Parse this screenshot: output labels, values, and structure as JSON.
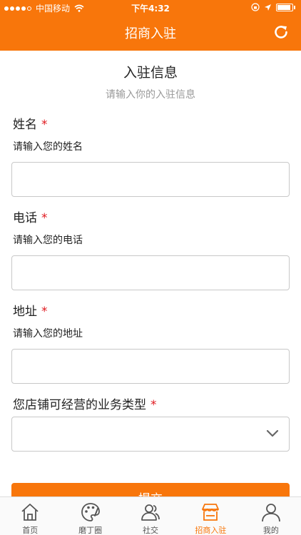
{
  "status_bar": {
    "carrier": "中国移动",
    "time": "下午4:32"
  },
  "nav": {
    "title": "招商入驻",
    "refresh_icon": "refresh-icon"
  },
  "form": {
    "title": "入驻信息",
    "subtitle": "请输入你的入驻信息",
    "required_mark": "*",
    "fields": [
      {
        "label": "姓名",
        "hint": "请输入您的姓名",
        "value": ""
      },
      {
        "label": "电话",
        "hint": "请输入您的电话",
        "value": ""
      },
      {
        "label": "地址",
        "hint": "请输入您的地址",
        "value": ""
      }
    ],
    "business_type": {
      "label": "您店铺可经营的业务类型",
      "selected": ""
    },
    "submit_label": "提交"
  },
  "tabbar": {
    "items": [
      {
        "label": "首页",
        "icon": "home-icon",
        "active": false
      },
      {
        "label": "磨丁圈",
        "icon": "palette-icon",
        "active": false
      },
      {
        "label": "社交",
        "icon": "people-icon",
        "active": false
      },
      {
        "label": "招商入驻",
        "icon": "store-icon",
        "active": true
      },
      {
        "label": "我的",
        "icon": "user-icon",
        "active": false
      }
    ]
  },
  "colors": {
    "brand": "#f8760b",
    "required": "#e0191f"
  }
}
